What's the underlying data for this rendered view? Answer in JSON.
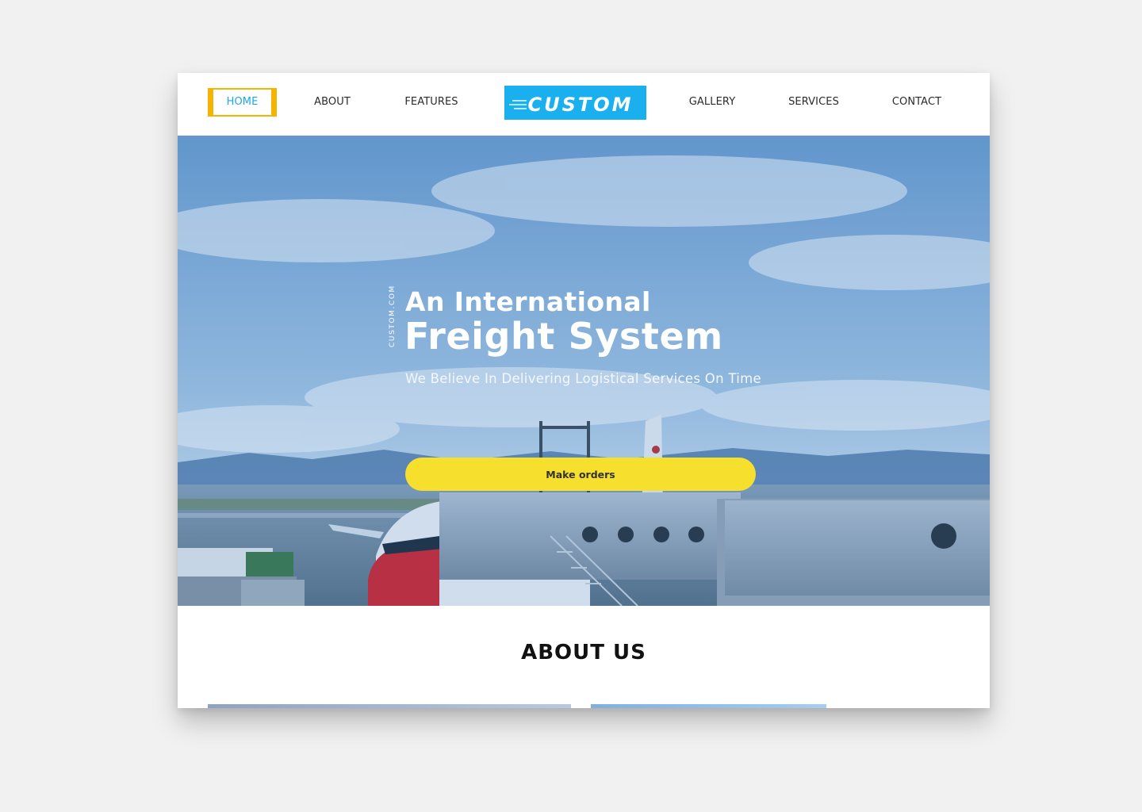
{
  "nav": {
    "items": [
      {
        "label": "HOME",
        "active": true
      },
      {
        "label": "ABOUT",
        "active": false
      },
      {
        "label": "FEATURES",
        "active": false
      },
      {
        "label": "GALLERY",
        "active": false
      },
      {
        "label": "SERVICES",
        "active": false
      },
      {
        "label": "CONTACT",
        "active": false
      }
    ],
    "logo_text": "CUSTOM"
  },
  "hero": {
    "vertical_tag": "CUSTOM.COM",
    "line1": "An International",
    "line2": "Freight System",
    "subtitle": "We Believe In Delivering Logistical Services On Time",
    "cta_label": "Make orders"
  },
  "about": {
    "title": "ABOUT US"
  },
  "colors": {
    "accent_blue": "#1aa7e8",
    "accent_yellow": "#f6b400",
    "cta_yellow": "#f7df2e"
  }
}
